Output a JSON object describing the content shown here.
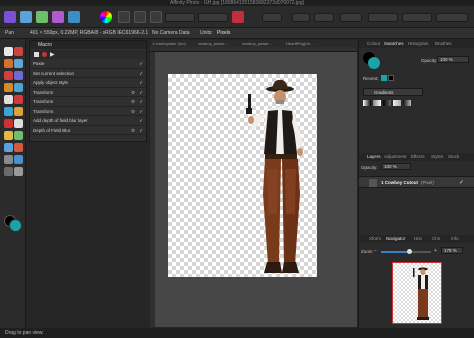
{
  "window": {
    "title": "Affinity Photo - GH.jpg [1808641351583682372d070072.jpg]"
  },
  "context": {
    "tool": "Pan",
    "doc_info": "401 × 550px, 0.22MP, RGBA/8 - sRGB IEC61966-2.1",
    "camera": "No Camera Data",
    "units_label": "Units:",
    "units_value": "Pixels"
  },
  "doc_tabs": [
    "1 cowboydale (Ion)",
    "cowboy_power...",
    "cowboy_power...",
    "HeadtPeg(Un..."
  ],
  "macro": {
    "title": "Macro",
    "rows": [
      {
        "label": "Paste",
        "gear": false,
        "check": "✓"
      },
      {
        "label": "Set current selection",
        "gear": false,
        "check": "✓"
      },
      {
        "label": "Apply object style",
        "gear": false,
        "check": "✓"
      },
      {
        "label": "Transform",
        "gear": true,
        "check": "✓"
      },
      {
        "label": "Transform",
        "gear": true,
        "check": "✓"
      },
      {
        "label": "Transform",
        "gear": true,
        "check": "✓"
      },
      {
        "label": "Add depth of field blur layer",
        "gear": false,
        "check": "✓"
      },
      {
        "label": "Depth of Field Blur",
        "gear": true,
        "check": "✓"
      }
    ]
  },
  "right": {
    "tabs1": [
      "Colour",
      "Swatches",
      "Histogram",
      "Brushes"
    ],
    "opacity_label": "Opacity:",
    "opacity_value": "100 %",
    "recent_label": "Recent:",
    "gradients_label": "Gradients",
    "tabs2": [
      "Layers",
      "Adjustment",
      "Effects",
      "Styles",
      "Stock"
    ],
    "layers_opacity_label": "Opacity:",
    "layers_opacity_value": "100 %",
    "layer_name": "1 Cowboy Cutout",
    "layer_kind": "(Pixel)",
    "tabs3": [
      "Xform",
      "Navigator",
      "Hist",
      "Chn",
      "Info"
    ],
    "zoom_label": "Zoom",
    "zoom_value": "178 %"
  },
  "status": {
    "text": "Drag to pan view."
  },
  "colors": {
    "accent": "#3b7fc4",
    "primary_swatch": "#1aa3a8"
  }
}
